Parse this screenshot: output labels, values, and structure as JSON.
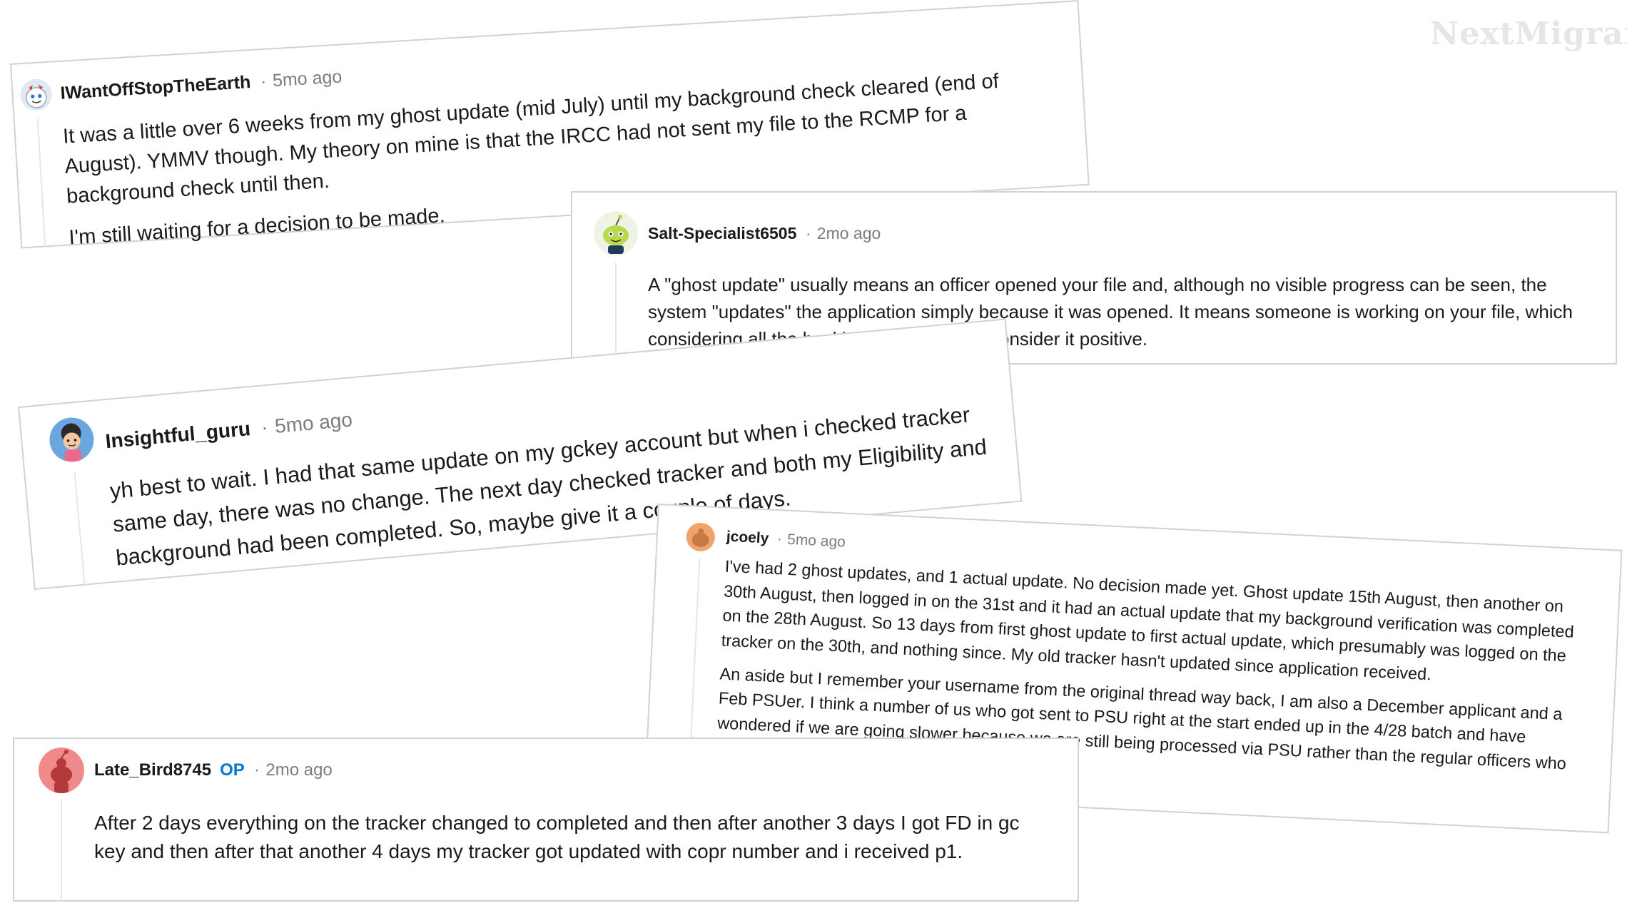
{
  "watermark": "NextMigrant",
  "comments": [
    {
      "username": "IWantOffStopTheEarth",
      "separator": "·",
      "age": "5mo ago",
      "paragraphs": [
        "It was a little over 6 weeks from my ghost update (mid July) until my background check cleared (end of August). YMMV though. My theory on mine is that the IRCC had not sent my file to the RCMP for a background check until then.",
        "I'm still waiting for a decision to be made."
      ]
    },
    {
      "username": "Salt-Specialist6505",
      "separator": "·",
      "age": "2mo ago",
      "paragraphs": [
        "A \"ghost update\" usually means an officer opened your file and, although no visible progress can be seen, the system \"updates\" the application simply because it was opened. It means someone is working on your file, which considering all the backlog that exists, I'd consider it positive."
      ]
    },
    {
      "username": "Insightful_guru",
      "separator": "·",
      "age": "5mo ago",
      "paragraphs": [
        "yh best to wait. I had that same update on my gckey account but when i checked tracker same day, there was no change. The next day checked tracker and both my Eligibility and background had been completed. So, maybe give it a couple of days."
      ]
    },
    {
      "username": "jcoely",
      "separator": "·",
      "age": "5mo ago",
      "paragraphs": [
        "I've had 2 ghost updates, and 1 actual update. No decision made yet. Ghost update 15th August, then another on 30th August, then logged in on the 31st and it had an actual update that my background verification was completed on the 28th August. So 13 days from first ghost update to first actual update, which presumably was logged on the tracker on the 30th, and nothing since. My old tracker hasn't updated since application received.",
        "An aside but I remember your username from the original thread way back, I am also a December applicant and a Feb PSUer. I think a number of us who got sent to PSU right at the start ended up in the 4/28 batch and have wondered if we are going slower because we are still being processed via PSU rather than the regular officers who are presumably processing everybody else."
      ]
    },
    {
      "username": "Late_Bird8745",
      "op_badge": "OP",
      "separator": "·",
      "age": "2mo ago",
      "paragraphs": [
        "After 2 days everything on the tracker changed to completed and then after another 3 days I got FD in gc key and then after that another 4 days my tracker got updated with copr number and i received p1."
      ]
    }
  ],
  "colors": {
    "username": "#1a1a1b",
    "meta": "#7c7c7c",
    "op_badge": "#0079d3",
    "border": "#cfd3d6",
    "watermark": "#e6e6e6"
  }
}
